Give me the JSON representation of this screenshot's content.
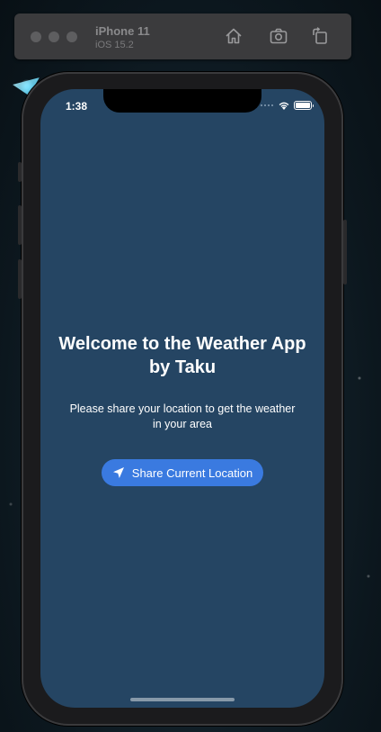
{
  "simulator": {
    "device_name": "iPhone 11",
    "os_version": "iOS 15.2",
    "icons": [
      "home-icon",
      "screenshot-icon",
      "rotate-icon"
    ]
  },
  "status_bar": {
    "time": "1:38"
  },
  "app": {
    "title": "Welcome to the Weather App by Taku",
    "subtitle": "Please share your location to get the weather in your area",
    "share_button_label": "Share Current Location",
    "share_button_icon": "location-arrow-icon"
  },
  "colors": {
    "screen_background": "#254563",
    "button_background": "#3a7ae0",
    "text": "#ffffff"
  }
}
